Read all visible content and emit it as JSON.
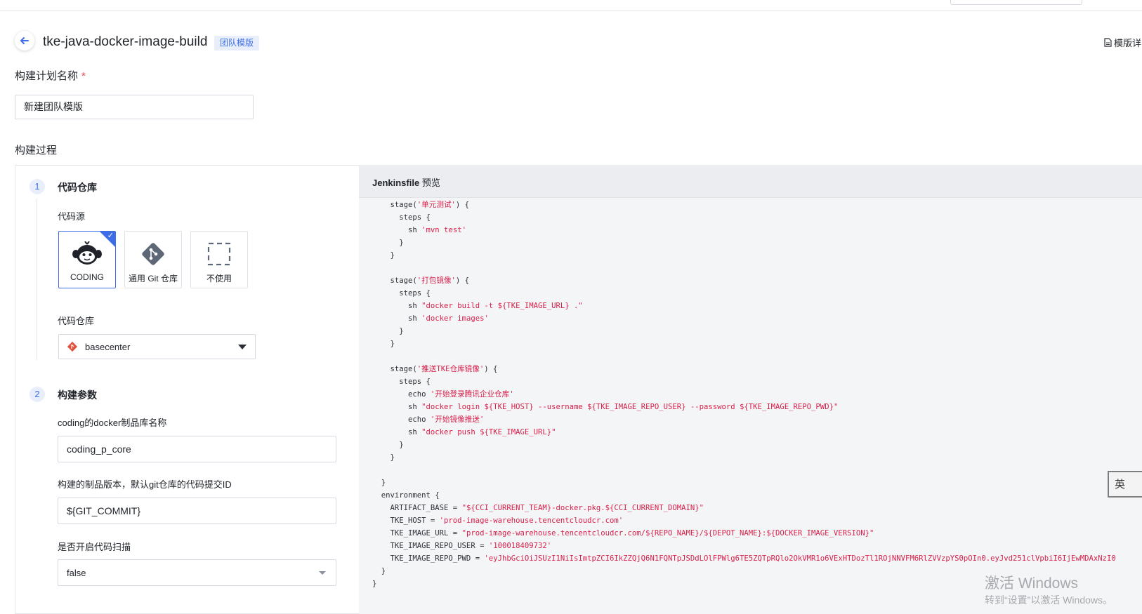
{
  "header": {
    "title": "tke-java-docker-image-build",
    "badge": "团队模版",
    "template_detail": "模版详"
  },
  "plan_name": {
    "label": "构建计划名称",
    "required_mark": "*",
    "value": "新建团队模版"
  },
  "process": {
    "label": "构建过程",
    "step1": {
      "number": "1",
      "title": "代码仓库",
      "source_label": "代码源",
      "sources": [
        {
          "label": "CODING",
          "icon": "coding-monkey-icon",
          "selected": true
        },
        {
          "label": "通用 Git 仓库",
          "icon": "git-icon",
          "selected": false
        },
        {
          "label": "不使用",
          "icon": "dashed-square-icon",
          "selected": false
        }
      ],
      "check_mark": "✓",
      "repo_label": "代码仓库",
      "repo_value": "basecenter"
    },
    "step2": {
      "number": "2",
      "title": "构建参数",
      "fields": [
        {
          "label": "coding的docker制品库名称",
          "value": "coding_p_core"
        },
        {
          "label": "构建的制品版本，默认git仓库的代码提交ID",
          "value": "${GIT_COMMIT}"
        },
        {
          "label": "是否开启代码扫描",
          "value": "false"
        }
      ]
    }
  },
  "jenkinsfile": {
    "title": "Jenkinsfile",
    "title_suffix": "预览",
    "lines": [
      [
        "    stage(",
        "'单元测试'",
        ") {"
      ],
      [
        "      steps {"
      ],
      [
        "        sh ",
        "'mvn test'"
      ],
      [
        "      }"
      ],
      [
        "    }"
      ],
      [
        ""
      ],
      [
        "    stage(",
        "'打包镜像'",
        ") {"
      ],
      [
        "      steps {"
      ],
      [
        "        sh ",
        "\"docker build -t ${TKE_IMAGE_URL} .\""
      ],
      [
        "        sh ",
        "'docker images'"
      ],
      [
        "      }"
      ],
      [
        "    }"
      ],
      [
        ""
      ],
      [
        "    stage(",
        "'推送TKE仓库镜像'",
        ") {"
      ],
      [
        "      steps {"
      ],
      [
        "        echo ",
        "'开始登录腾讯企业仓库'"
      ],
      [
        "        sh ",
        "\"docker login ${TKE_HOST} --username ${TKE_IMAGE_REPO_USER} --password ${TKE_IMAGE_REPO_PWD}\""
      ],
      [
        "        echo ",
        "'开始镜像推送'"
      ],
      [
        "        sh ",
        "\"docker push ${TKE_IMAGE_URL}\""
      ],
      [
        "      }"
      ],
      [
        "    }"
      ],
      [
        ""
      ],
      [
        "  }"
      ],
      [
        "  environment {"
      ],
      [
        "    ARTIFACT_BASE = ",
        "\"${CCI_CURRENT_TEAM}-docker.pkg.${CCI_CURRENT_DOMAIN}\""
      ],
      [
        "    TKE_HOST = ",
        "'prod-image-warehouse.tencentcloudcr.com'"
      ],
      [
        "    TKE_IMAGE_URL = ",
        "\"prod-image-warehouse.tencentcloudcr.com/${REPO_NAME}/${DEPOT_NAME}:${DOCKER_IMAGE_VERSION}\""
      ],
      [
        "    TKE_IMAGE_REPO_USER = ",
        "'100018409732'"
      ],
      [
        "    TKE_IMAGE_REPO_PWD = ",
        "'eyJhbGciOiJSUzI1NiIsImtpZCI6IkZZQjQ6N1FQNTpJSDdLOlFPWlg6TE5ZQTpRQlo2OkVMR1o6VExHTDozTl1ROjNNVFM6RlZVVzpYS0pOIn0.eyJvd251clVpbiI6IjEwMDAxNzI0"
      ],
      [
        "  }"
      ],
      [
        "}"
      ]
    ]
  },
  "ime": {
    "char": "英"
  },
  "watermark": {
    "title": "激活 Windows",
    "subtitle": "转到“设置”以激活 Windows。"
  },
  "colors": {
    "accent": "#3d6ee8",
    "string": "#d8204a",
    "code_bg": "#f4f5f7"
  }
}
